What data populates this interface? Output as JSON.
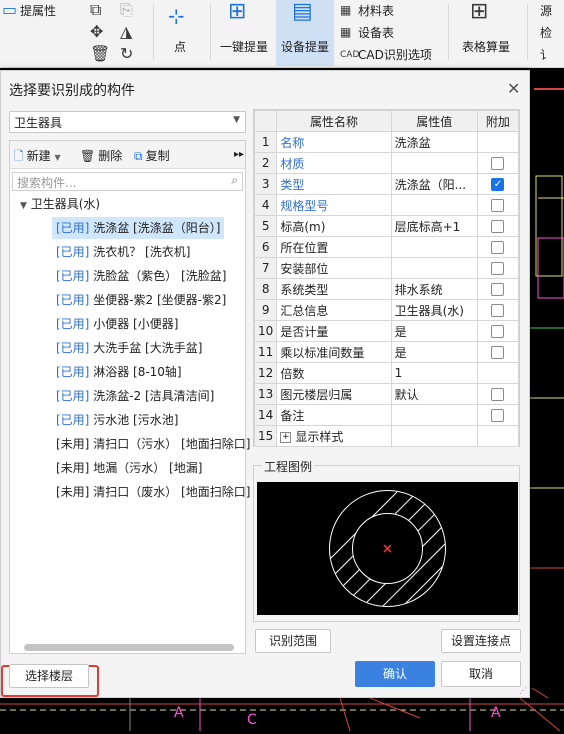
{
  "ribbon": {
    "left_label": "提属性",
    "point_label": "点",
    "one_key_label": "一键提量",
    "device_label": "设备提量",
    "material_table": "材料表",
    "device_table": "设备表",
    "cad_option": "CAD识别选项",
    "table_calc": "表格算量",
    "right_frag1": "源",
    "right_frag2": "检",
    "right_frag3": "讠"
  },
  "dialog": {
    "title": "选择要识别成的构件",
    "component_type": "卫生器具",
    "toolbar": {
      "new": "新建",
      "delete": "删除",
      "copy": "复制"
    },
    "search_placeholder": "搜索构件...",
    "tree_root": "卫生器具(水)",
    "tree_items": [
      {
        "status": "[已用]",
        "name": "洗涤盆 [洗涤盆（阳台）]",
        "used": true,
        "selected": true
      },
      {
        "status": "[已用]",
        "name": "洗衣机？ [洗衣机]",
        "used": true,
        "selected": false
      },
      {
        "status": "[已用]",
        "name": "洗脸盆（紫色） [洗脸盆]",
        "used": true,
        "selected": false
      },
      {
        "status": "[已用]",
        "name": "坐便器-紫2 [坐便器-紫2]",
        "used": true,
        "selected": false
      },
      {
        "status": "[已用]",
        "name": "小便器 [小便器]",
        "used": true,
        "selected": false
      },
      {
        "status": "[已用]",
        "name": "大洗手盆 [大洗手盆]",
        "used": true,
        "selected": false
      },
      {
        "status": "[已用]",
        "name": "淋浴器 [8-10轴]",
        "used": true,
        "selected": false
      },
      {
        "status": "[已用]",
        "name": "洗涤盆-2 [洁具清洁间]",
        "used": true,
        "selected": false
      },
      {
        "status": "[已用]",
        "name": "污水池 [污水池]",
        "used": true,
        "selected": false
      },
      {
        "status": "[未用]",
        "name": "清扫口（污水） [地面扫除口]",
        "used": false,
        "selected": false
      },
      {
        "status": "[未用]",
        "name": "地漏（污水） [地漏]",
        "used": false,
        "selected": false
      },
      {
        "status": "[未用]",
        "name": "清扫口（废水） [地面扫除口]",
        "used": false,
        "selected": false
      }
    ],
    "grid_headers": {
      "name": "属性名称",
      "value": "属性值",
      "add": "附加"
    },
    "properties": [
      {
        "num": "1",
        "name": "名称",
        "value": "洗涤盆",
        "blue": true,
        "check": "none"
      },
      {
        "num": "2",
        "name": "材质",
        "value": "",
        "blue": true,
        "check": "off"
      },
      {
        "num": "3",
        "name": "类型",
        "value": "洗涤盆（阳...",
        "blue": true,
        "check": "on"
      },
      {
        "num": "4",
        "name": "规格型号",
        "value": "",
        "blue": true,
        "check": "off"
      },
      {
        "num": "5",
        "name": "标高(m)",
        "value": "层底标高+1",
        "blue": false,
        "check": "off"
      },
      {
        "num": "6",
        "name": "所在位置",
        "value": "",
        "blue": false,
        "check": "off"
      },
      {
        "num": "7",
        "name": "安装部位",
        "value": "",
        "blue": false,
        "check": "off"
      },
      {
        "num": "8",
        "name": "系统类型",
        "value": "排水系统",
        "blue": false,
        "check": "off"
      },
      {
        "num": "9",
        "name": "汇总信息",
        "value": "卫生器具(水)",
        "blue": false,
        "check": "off"
      },
      {
        "num": "10",
        "name": "是否计量",
        "value": "是",
        "blue": false,
        "check": "off"
      },
      {
        "num": "11",
        "name": "乘以标准间数量",
        "value": "是",
        "blue": false,
        "check": "off"
      },
      {
        "num": "12",
        "name": "倍数",
        "value": "1",
        "blue": false,
        "check": "none"
      },
      {
        "num": "13",
        "name": "图元楼层归属",
        "value": "默认",
        "blue": false,
        "check": "off"
      },
      {
        "num": "14",
        "name": "备注",
        "value": "",
        "blue": false,
        "check": "off"
      },
      {
        "num": "15",
        "name": "显示样式",
        "value": "",
        "blue": false,
        "check": "none",
        "expand": true
      }
    ],
    "legend_title": "工程图例",
    "btn_identify_range": "识别范围",
    "btn_set_connect": "设置连接点",
    "btn_select_floor": "选择楼层",
    "btn_confirm": "确认",
    "btn_cancel": "取消"
  },
  "cad_labels": {
    "a1": "A",
    "c1": "C",
    "a2": "A"
  },
  "colors": {
    "accent": "#3b82e0",
    "selected_row": "#cfe6fb",
    "used_text": "#2f6fd6",
    "highlight_border": "#e53935"
  }
}
